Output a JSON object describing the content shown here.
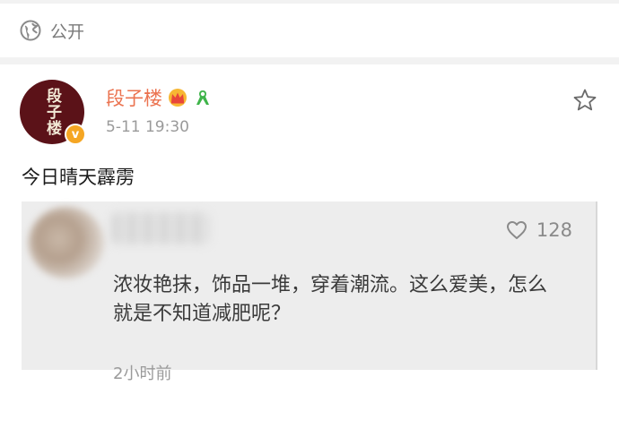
{
  "visibility": {
    "label": "公开",
    "icon": "globe-icon"
  },
  "post": {
    "username": "段子楼",
    "avatar_text": "段子楼",
    "timestamp": "5-11 19:30",
    "text": "今日晴天霹雳",
    "badges": [
      "crown-badge-icon",
      "ribbon-badge-icon"
    ],
    "verified_mark": "v"
  },
  "embedded_comment": {
    "likes": "128",
    "text": "浓妆艳抹，饰品一堆，穿着潮流。这么爱美，怎么就是不知道减肥呢？",
    "time": "2小时前"
  },
  "colors": {
    "username": "#eb7350",
    "verified": "#f5a623",
    "avatar_bg": "#5b1218"
  }
}
